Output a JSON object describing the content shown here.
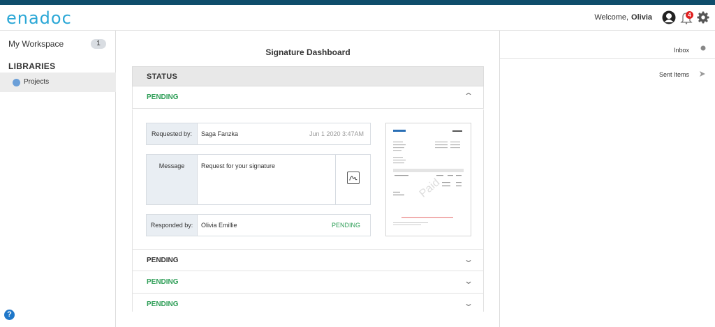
{
  "header": {
    "logo": "enadoc",
    "welcome": "Welcome,",
    "user": "Olivia",
    "notification_count": "4"
  },
  "sidebar": {
    "workspace_label": "My Workspace",
    "workspace_count": "1",
    "libraries_heading": "LIBRARIES",
    "items": [
      {
        "label": "Projects",
        "color": "#6b9fd8"
      }
    ],
    "help": "?"
  },
  "main": {
    "title": "Signature Dashboard",
    "status_heading": "STATUS",
    "rows": [
      {
        "label": "PENDING",
        "color": "#2e9e57"
      },
      {
        "label": "PENDING",
        "color": "#333333"
      },
      {
        "label": "PENDING",
        "color": "#2e9e57"
      },
      {
        "label": "PENDING",
        "color": "#2e9e57"
      }
    ],
    "detail": {
      "requested_by_label": "Requested by:",
      "requested_by": "Saga Fanzka",
      "requested_at": "Jun 1 2020 3:47AM",
      "message_label": "Message",
      "message": "Request for your signature",
      "responded_by_label": "Responded by:",
      "responded_by": "Olivia Emillie",
      "response_status": "PENDING"
    }
  },
  "right_pane": {
    "items": [
      {
        "label": "Inbox",
        "icon": "dot-icon"
      },
      {
        "label": "Sent Items",
        "icon": "send-arrow-icon"
      }
    ]
  },
  "colors": {
    "brand": "#2aa7d6",
    "top_strip": "#0f4d6b",
    "pending_green": "#2e9e57",
    "badge": "#e02020"
  }
}
